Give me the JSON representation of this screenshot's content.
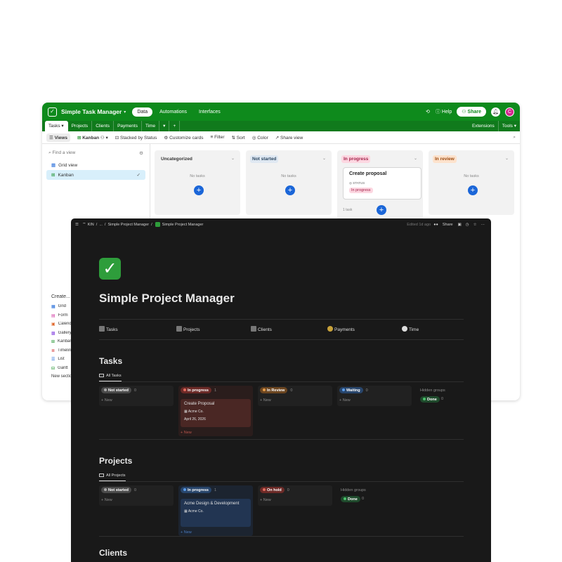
{
  "airtable": {
    "base_title": "Simple Task Manager",
    "nav": [
      "Data",
      "Automations",
      "Interfaces"
    ],
    "help": "Help",
    "share": "Share",
    "avatar_initial": "C",
    "tables": [
      "Tasks",
      "Projects",
      "Clients",
      "Payments",
      "Time"
    ],
    "extensions": "Extensions",
    "tools": "Tools",
    "toolbar": {
      "views": "Views",
      "view_name": "Kanban",
      "stacked": "Stacked by Status",
      "customize": "Customize cards",
      "filter": "Filter",
      "sort": "Sort",
      "color": "Color",
      "share_view": "Share view"
    },
    "find_placeholder": "Find a view",
    "views": [
      "Grid view",
      "Kanban"
    ],
    "create_label": "Create...",
    "create_items": [
      "Grid",
      "Form",
      "Calendar",
      "Gallery",
      "Kanban",
      "Timeline",
      "List",
      "Gantt"
    ],
    "new_section": "New section",
    "columns": [
      {
        "name": "Uncategorized",
        "empty": "No tasks",
        "color": "#f2f2f2",
        "text": "#333"
      },
      {
        "name": "Not started",
        "empty": "No tasks",
        "color": "#dfe8f2",
        "text": "#2c4660"
      },
      {
        "name": "In progress",
        "empty": "",
        "color": "#fcd7e1",
        "text": "#a3224a",
        "footer": "1 task"
      },
      {
        "name": "In review",
        "empty": "No tasks",
        "color": "#fde2cc",
        "text": "#9a4a10"
      }
    ],
    "card": {
      "title": "Create proposal",
      "status_label": "STATUS",
      "status": "In progress"
    }
  },
  "notion": {
    "breadcrumb": {
      "workspace": "KIN",
      "ellipsis": "...",
      "parent": "Simple Project Manager",
      "current": "Simple Project Manager"
    },
    "edited": "Edited 1d ago",
    "share": "Share",
    "icon": "✓",
    "title": "Simple Project Manager",
    "links": [
      "Tasks",
      "Projects",
      "Clients",
      "Payments",
      "Time"
    ],
    "tasks": {
      "heading": "Tasks",
      "view": "All Tasks",
      "groups": [
        {
          "label": "Not started",
          "count": "0",
          "new": "+ New",
          "tag": "#4a4a4a",
          "dot": "#aaa"
        },
        {
          "label": "In progress",
          "count": "1",
          "new": "+ New",
          "tag": "#6b2a27",
          "dot": "#e26a5d",
          "card": {
            "title": "Create Proposal",
            "client": "Acme Co.",
            "date": "April 26, 2026"
          }
        },
        {
          "label": "In Review",
          "count": "0",
          "new": "+ New",
          "tag": "#6b4520",
          "dot": "#e59b48"
        },
        {
          "label": "Waiting",
          "count": "0",
          "new": "+ New",
          "tag": "#28456b",
          "dot": "#5a9be8"
        }
      ],
      "hidden_label": "Hidden groups",
      "hidden": {
        "label": "Done",
        "count": "0"
      }
    },
    "projects": {
      "heading": "Projects",
      "view": "All Projects",
      "groups": [
        {
          "label": "Not started",
          "count": "0",
          "new": "+ New",
          "tag": "#4a4a4a",
          "dot": "#aaa"
        },
        {
          "label": "In progress",
          "count": "1",
          "new": "+ New",
          "tag": "#28456b",
          "dot": "#5a9be8",
          "card": {
            "title": "Acme Design & Development",
            "client": "Acme Co."
          }
        },
        {
          "label": "On hold",
          "count": "0",
          "new": "+ New",
          "tag": "#6b2a27",
          "dot": "#e26a5d"
        }
      ],
      "hidden_label": "Hidden groups",
      "hidden": {
        "label": "Done",
        "count": "0"
      }
    },
    "clients_heading": "Clients"
  }
}
